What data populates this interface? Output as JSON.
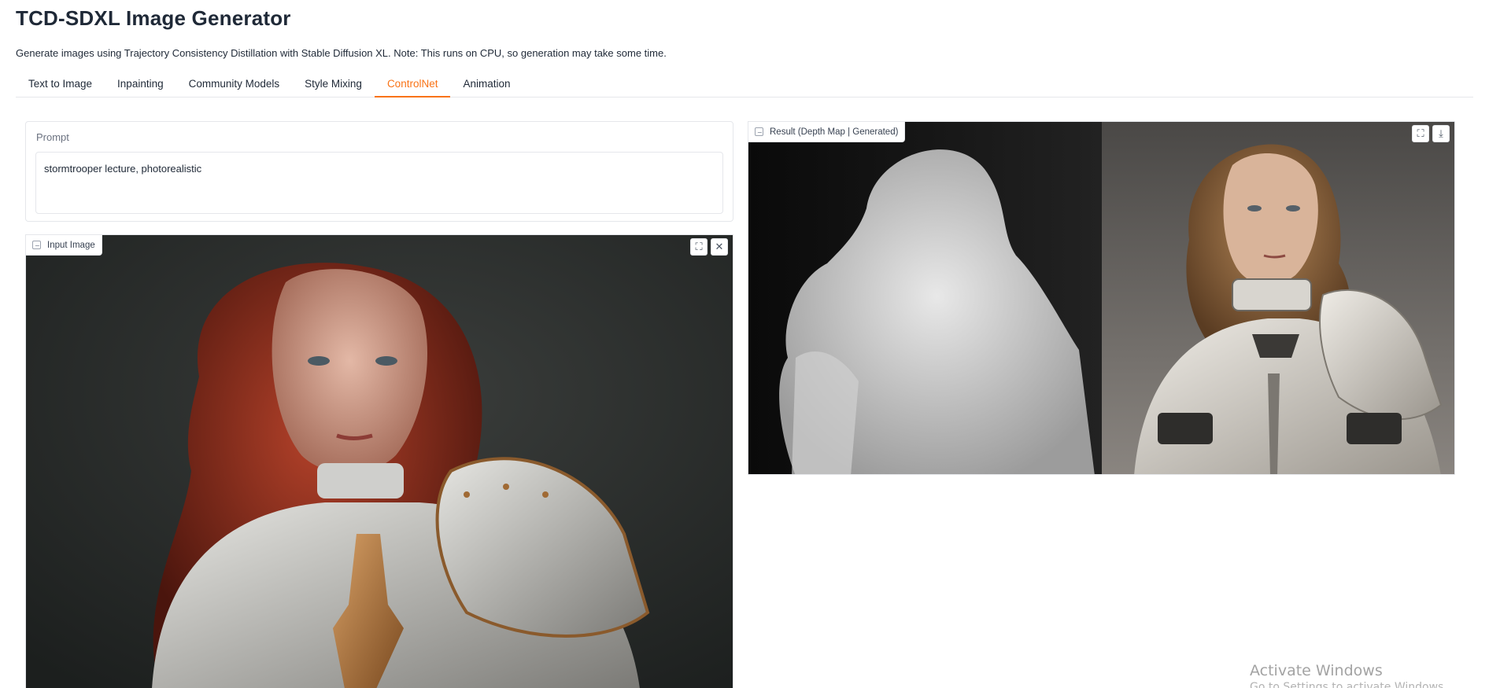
{
  "header": {
    "title": "TCD-SDXL Image Generator",
    "description": "Generate images using Trajectory Consistency Distillation with Stable Diffusion XL. Note: This runs on CPU, so generation may take some time."
  },
  "tabs": [
    {
      "label": "Text to Image",
      "active": false
    },
    {
      "label": "Inpainting",
      "active": false
    },
    {
      "label": "Community Models",
      "active": false
    },
    {
      "label": "Style Mixing",
      "active": false
    },
    {
      "label": "ControlNet",
      "active": true
    },
    {
      "label": "Animation",
      "active": false
    }
  ],
  "prompt": {
    "label": "Prompt",
    "value": "stormtrooper lecture, photorealistic"
  },
  "input_image": {
    "label": "Input Image",
    "icons": [
      "fullscreen-icon",
      "close-icon"
    ]
  },
  "result_image": {
    "label": "Result (Depth Map | Generated)",
    "icons": [
      "fullscreen-icon",
      "download-icon"
    ]
  },
  "watermark": {
    "line1": "Activate Windows",
    "line2": "Go to Settings to activate Windows."
  },
  "colors": {
    "accent": "#f97316",
    "border": "#e5e7eb",
    "text": "#1f2937"
  }
}
